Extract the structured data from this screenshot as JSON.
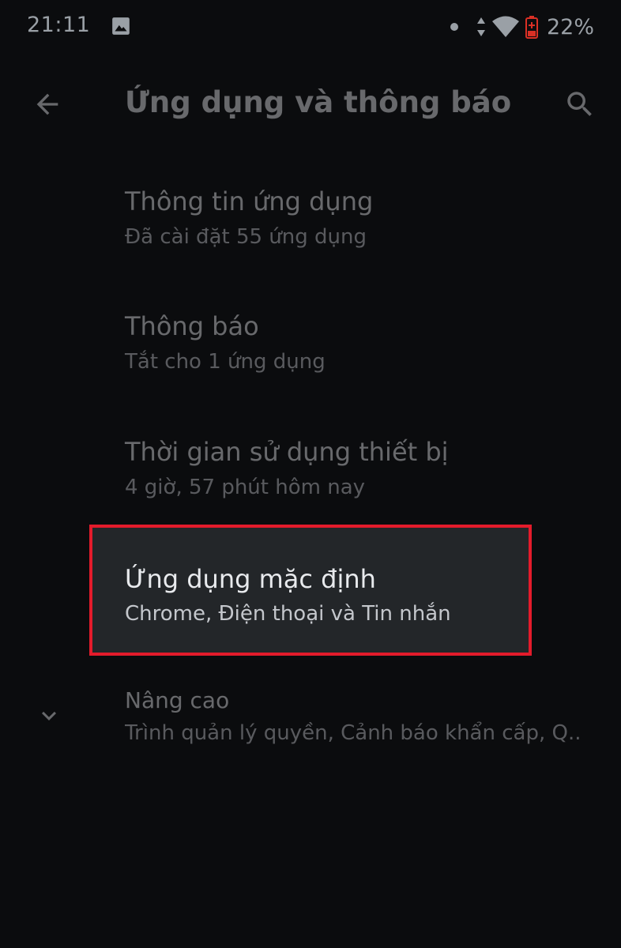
{
  "status_bar": {
    "time": "21:11",
    "battery_percent": "22%",
    "icons": [
      "gallery-icon",
      "notification-dot-icon",
      "data-transfer-icon",
      "wifi-icon",
      "battery-charging-icon"
    ]
  },
  "toolbar": {
    "title": "Ứng dụng và thông báo",
    "back_icon": "arrow-back-icon",
    "search_icon": "search-icon"
  },
  "items": [
    {
      "title": "Thông tin ứng dụng",
      "summary": "Đã cài đặt 55 ứng dụng"
    },
    {
      "title": "Thông báo",
      "summary": "Tắt cho 1 ứng dụng"
    },
    {
      "title": "Thời gian sử dụng thiết bị",
      "summary": "4 giờ, 57 phút hôm nay"
    },
    {
      "title": "Ứng dụng mặc định",
      "summary": "Chrome, Điện thoại và Tin nhắn"
    },
    {
      "title": "Nâng cao",
      "summary": "Trình quản lý quyền, Cảnh báo khẩn cấp, Q.."
    }
  ],
  "colors": {
    "background": "#0b0c0e",
    "highlight_border": "#e31b2b",
    "highlight_fill": "#232629",
    "text_primary": "#e8eaed",
    "text_secondary": "#9aa0a6"
  }
}
